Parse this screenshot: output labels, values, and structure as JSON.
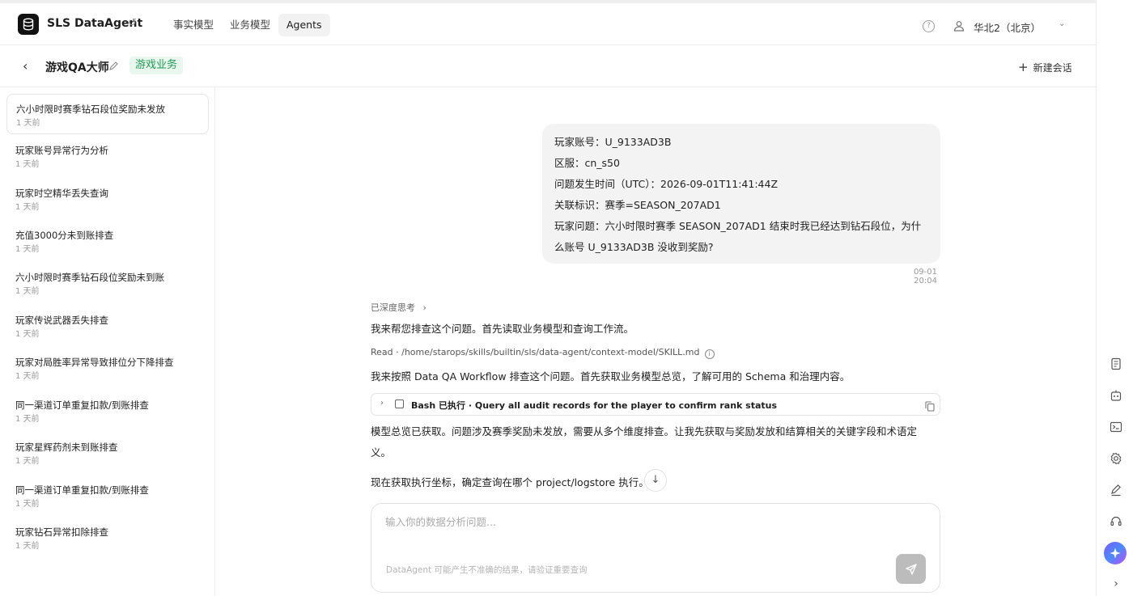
{
  "app": {
    "brand": "SLS DataAgent",
    "nav_tabs": [
      "事实模型",
      "业务模型",
      "Agents"
    ],
    "active_tab": "Agents",
    "region": "华北2（北京）"
  },
  "subheader": {
    "agent_name": "游戏QA大师",
    "tag": "游戏业务",
    "new_chat_label": "新建会话"
  },
  "sidebar": {
    "items": [
      {
        "title": "六小时限时赛季钻石段位奖励未发放",
        "time": "1 天前"
      },
      {
        "title": "玩家账号异常行为分析",
        "time": "1 天前"
      },
      {
        "title": "玩家时空精华丢失查询",
        "time": "1 天前"
      },
      {
        "title": "充值3000分未到账排查",
        "time": "1 天前"
      },
      {
        "title": "六小时限时赛季钻石段位奖励未到账",
        "time": "1 天前"
      },
      {
        "title": "玩家传说武器丢失排查",
        "time": "1 天前"
      },
      {
        "title": "玩家对局胜率异常导致排位分下降排查",
        "time": "1 天前"
      },
      {
        "title": "同一渠道订单重复扣款/到账排查",
        "time": "1 天前"
      },
      {
        "title": "玩家星辉药剂未到账排查",
        "time": "1 天前"
      },
      {
        "title": "同一渠道订单重复扣款/到账排查",
        "time": "1 天前"
      },
      {
        "title": "玩家钻石异常扣除排查",
        "time": "1 天前"
      }
    ]
  },
  "chat": {
    "user_message": {
      "lines": [
        "玩家账号：U_9133AD3B",
        "区服：cn_s50",
        "问题发生时间（UTC）：2026-09-01T11:41:44Z",
        "关联标识：赛季=SEASON_207AD1",
        "玩家问题：六小时限时赛季 SEASON_207AD1 结束时我已经达到钻石段位，为什",
        "么账号 U_9133AD3B 没收到奖励?"
      ],
      "time": "09-01 20:04"
    },
    "thought_label": "已深度思考",
    "para1": "我来帮您排查这个问题。首先读取业务模型和查询工作流。",
    "read_line": "Read · /home/starops/skills/builtin/sls/data-agent/context-model/SKILL.md",
    "para2": "我来按照 Data QA Workflow 排查这个问题。首先获取业务模型总览，了解可用的 Schema 和治理内容。",
    "tool_label": "Bash 已执行 · Query all audit records for the player to confirm rank status",
    "para3_line1": "模型总览已获取。问题涉及赛季奖励未发放，需要从多个维度排查。让我先获取与奖励发放和结算相关的关键字段和术语定",
    "para3_line2": "义。",
    "para4": "现在获取执行坐标，确定查询在哪个 project/logstore 执行。"
  },
  "composer": {
    "placeholder": "输入你的数据分析问题...",
    "disclaimer": "DataAgent 可能产生不准确的结果，请验证重要查询"
  }
}
